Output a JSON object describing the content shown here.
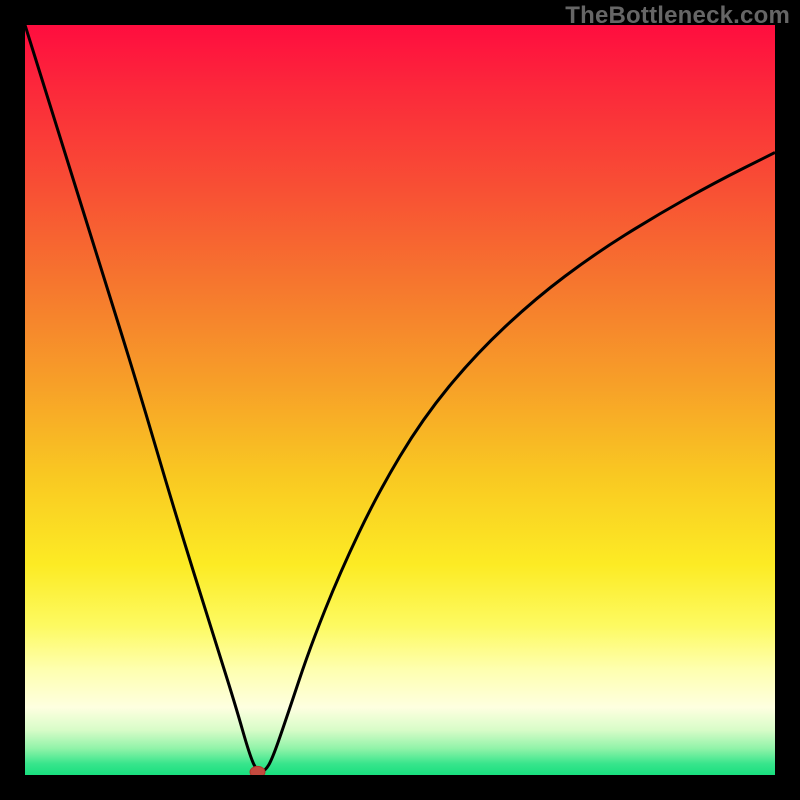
{
  "watermark": "TheBottleneck.com",
  "colors": {
    "frame": "#000000",
    "curve": "#000000",
    "marker_fill": "#c44a3f",
    "marker_stroke": "#b3362c",
    "gradient_stops": [
      {
        "offset": 0.0,
        "color": "#ff0d3f"
      },
      {
        "offset": 0.1,
        "color": "#fb2d3a"
      },
      {
        "offset": 0.22,
        "color": "#f85034"
      },
      {
        "offset": 0.35,
        "color": "#f6782e"
      },
      {
        "offset": 0.48,
        "color": "#f7a028"
      },
      {
        "offset": 0.6,
        "color": "#f9c822"
      },
      {
        "offset": 0.72,
        "color": "#fceb24"
      },
      {
        "offset": 0.8,
        "color": "#fdfa60"
      },
      {
        "offset": 0.86,
        "color": "#feffb0"
      },
      {
        "offset": 0.91,
        "color": "#feffe0"
      },
      {
        "offset": 0.94,
        "color": "#d8fcc8"
      },
      {
        "offset": 0.965,
        "color": "#8ff3a8"
      },
      {
        "offset": 0.985,
        "color": "#38e58c"
      },
      {
        "offset": 1.0,
        "color": "#18df7e"
      }
    ]
  },
  "chart_data": {
    "type": "line",
    "title": "",
    "xlabel": "",
    "ylabel": "",
    "xlim": [
      0,
      100
    ],
    "ylim": [
      0,
      100
    ],
    "annotations": [
      "TheBottleneck.com"
    ],
    "series": [
      {
        "name": "bottleneck-curve",
        "comment": "V-shaped bottleneck curve; minimum ≈ (31, 0). Left branch nearly linear from top-left corner to the minimum; right branch rises with decreasing slope toward upper right, reaching ≈ (100, 83).",
        "x": [
          0,
          5,
          10,
          15,
          20,
          25,
          28,
          30,
          31,
          32,
          33,
          35,
          38,
          42,
          47,
          53,
          60,
          68,
          76,
          84,
          92,
          100
        ],
        "y": [
          100,
          84,
          68,
          52,
          35,
          19,
          9.5,
          2.5,
          0.4,
          0.5,
          2.2,
          8,
          17,
          27,
          37.5,
          47.5,
          56,
          63.5,
          69.5,
          74.5,
          79,
          83
        ]
      }
    ],
    "marker": {
      "x": 31,
      "y": 0.4,
      "rx": 1.0,
      "ry": 0.75
    }
  }
}
